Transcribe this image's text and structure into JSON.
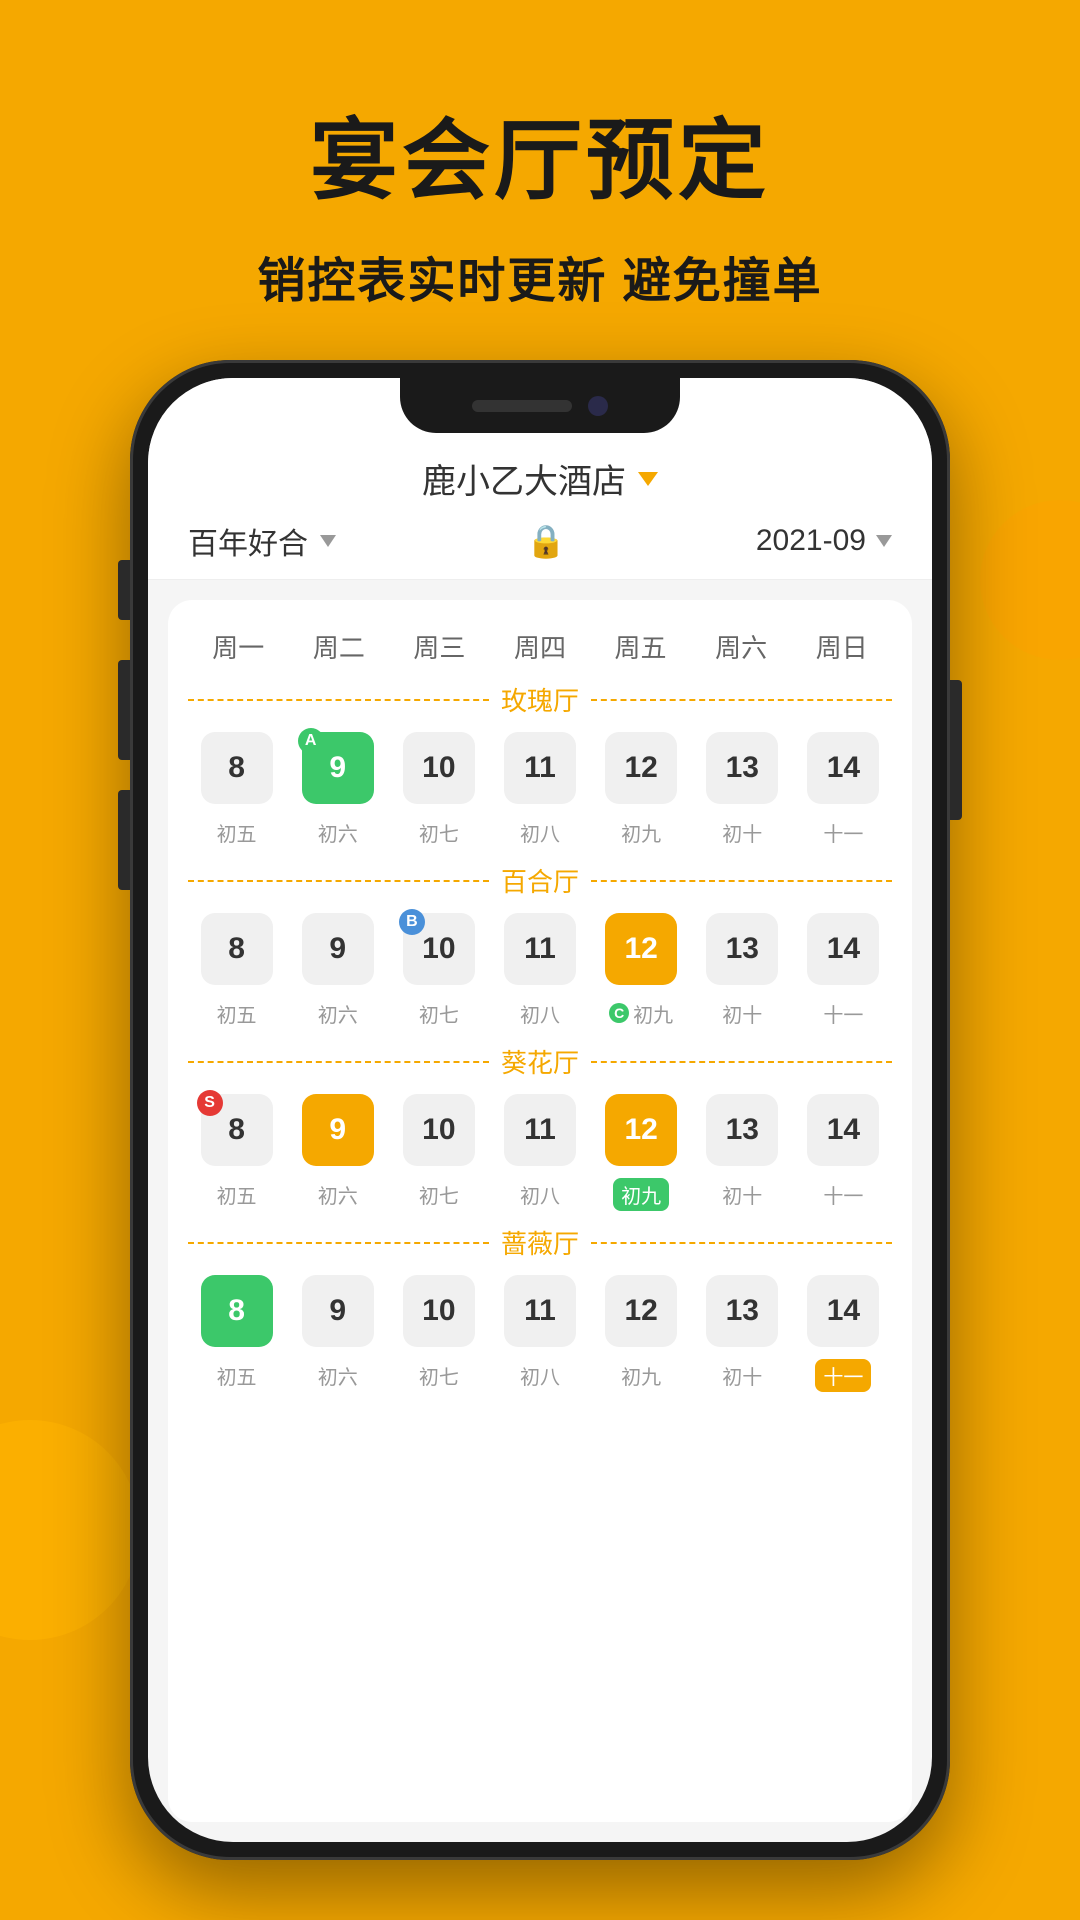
{
  "page": {
    "title": "宴会厅预定",
    "subtitle": "销控表实时更新  避免撞单",
    "bg_color": "#F5A800"
  },
  "app": {
    "hotel_name": "鹿小乙大酒店",
    "filter_label": "百年好合",
    "date_label": "2021-09",
    "weekdays": [
      "周一",
      "周二",
      "周三",
      "周四",
      "周五",
      "周六",
      "周日"
    ],
    "halls": [
      {
        "name": "玫瑰厅",
        "dates": [
          {
            "num": "8",
            "lunar": "初五",
            "style": "default",
            "badge": null
          },
          {
            "num": "9",
            "lunar": "初六",
            "style": "green",
            "badge": "A"
          },
          {
            "num": "10",
            "lunar": "初七",
            "style": "default",
            "badge": null
          },
          {
            "num": "11",
            "lunar": "初八",
            "style": "default",
            "badge": null
          },
          {
            "num": "12",
            "lunar": "初九",
            "style": "default",
            "badge": null
          },
          {
            "num": "13",
            "lunar": "初十",
            "style": "default",
            "badge": null
          },
          {
            "num": "14",
            "lunar": "十一",
            "style": "default",
            "badge": null
          }
        ]
      },
      {
        "name": "百合厅",
        "dates": [
          {
            "num": "8",
            "lunar": "初五",
            "style": "default",
            "badge": null
          },
          {
            "num": "9",
            "lunar": "初六",
            "style": "default",
            "badge": null
          },
          {
            "num": "10",
            "lunar": "初七",
            "style": "default",
            "badge": "B"
          },
          {
            "num": "11",
            "lunar": "初八",
            "style": "default",
            "badge": null
          },
          {
            "num": "12",
            "lunar": "初九",
            "style": "yellow",
            "badge": null,
            "lunar_style": "badge_c"
          },
          {
            "num": "13",
            "lunar": "初十",
            "style": "default",
            "badge": null
          },
          {
            "num": "14",
            "lunar": "十一",
            "style": "default",
            "badge": null
          }
        ]
      },
      {
        "name": "葵花厅",
        "dates": [
          {
            "num": "8",
            "lunar": "初五",
            "style": "default",
            "badge": "S_red"
          },
          {
            "num": "9",
            "lunar": "初六",
            "style": "yellow",
            "badge": null
          },
          {
            "num": "10",
            "lunar": "初七",
            "style": "default",
            "badge": null
          },
          {
            "num": "11",
            "lunar": "初八",
            "style": "default",
            "badge": null
          },
          {
            "num": "12",
            "lunar": "初九",
            "style": "yellow",
            "badge": null,
            "lunar_green": true
          },
          {
            "num": "13",
            "lunar": "初十",
            "style": "default",
            "badge": null
          },
          {
            "num": "14",
            "lunar": "十一",
            "style": "default",
            "badge": null
          }
        ]
      },
      {
        "name": "蔷薇厅",
        "dates": [
          {
            "num": "8",
            "lunar": "初五",
            "style": "green",
            "badge": null
          },
          {
            "num": "9",
            "lunar": "初六",
            "style": "default",
            "badge": null
          },
          {
            "num": "10",
            "lunar": "初七",
            "style": "default",
            "badge": null
          },
          {
            "num": "11",
            "lunar": "初八",
            "style": "default",
            "badge": null
          },
          {
            "num": "12",
            "lunar": "初九",
            "style": "default",
            "badge": null
          },
          {
            "num": "13",
            "lunar": "初十",
            "style": "default",
            "badge": null
          },
          {
            "num": "14",
            "lunar": "十一",
            "style": "yellow_lunar",
            "badge": null
          }
        ]
      }
    ]
  }
}
